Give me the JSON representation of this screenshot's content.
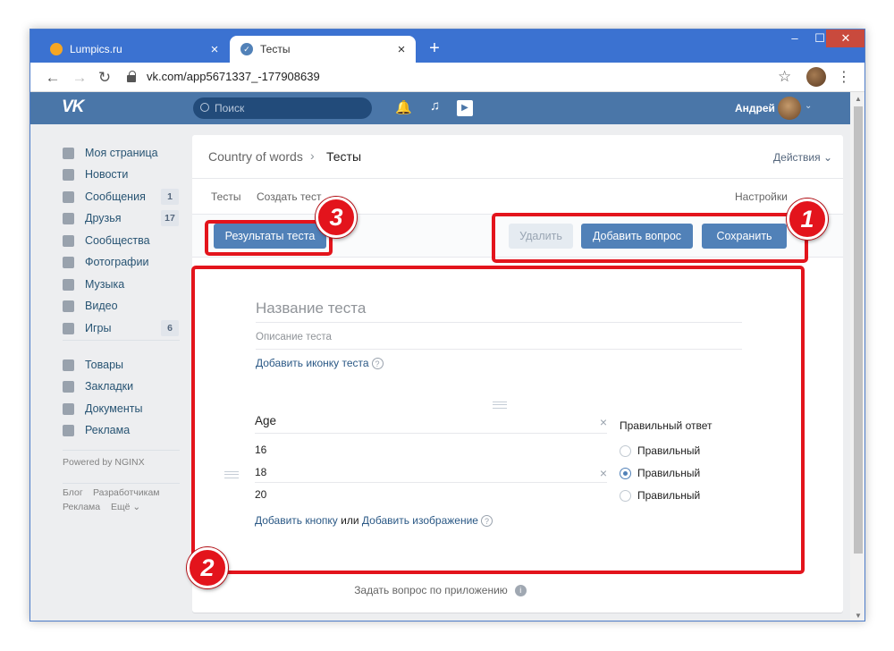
{
  "browser": {
    "tabs": [
      {
        "title": "Lumpics.ru",
        "close": "×"
      },
      {
        "title": "Тесты",
        "close": "×"
      }
    ],
    "new_tab": "+",
    "window_controls": {
      "minimize": "‒",
      "maximize": "☐",
      "close": "✕"
    },
    "nav": {
      "back": "←",
      "forward": "→",
      "reload": "↻"
    },
    "url": "vk.com/app5671337_-177908639",
    "star": "☆",
    "menu": "⋮"
  },
  "vk_header": {
    "logo": "VK",
    "search_placeholder": "Поиск",
    "bell": "🔔",
    "music": "♫",
    "play": "▶",
    "user_name": "Андрей",
    "user_chevron": "⌄"
  },
  "left_menu": {
    "items": [
      {
        "label": "Моя страница",
        "icon": "home-icon",
        "badge": ""
      },
      {
        "label": "Новости",
        "icon": "news-icon",
        "badge": ""
      },
      {
        "label": "Сообщения",
        "icon": "messages-icon",
        "badge": "1"
      },
      {
        "label": "Друзья",
        "icon": "friends-icon",
        "badge": "17"
      },
      {
        "label": "Сообщества",
        "icon": "communities-icon",
        "badge": ""
      },
      {
        "label": "Фотографии",
        "icon": "photos-icon",
        "badge": ""
      },
      {
        "label": "Музыка",
        "icon": "music-icon",
        "badge": ""
      },
      {
        "label": "Видео",
        "icon": "video-icon",
        "badge": ""
      },
      {
        "label": "Игры",
        "icon": "games-icon",
        "badge": "6"
      },
      {
        "label": "Товары",
        "icon": "goods-icon",
        "badge": ""
      },
      {
        "label": "Закладки",
        "icon": "bookmarks-icon",
        "badge": ""
      },
      {
        "label": "Документы",
        "icon": "documents-icon",
        "badge": ""
      },
      {
        "label": "Реклама",
        "icon": "ads-icon",
        "badge": ""
      }
    ],
    "powered_by": "Powered by NGINX",
    "footer_links": [
      "Блог",
      "Разработчикам",
      "Реклама",
      "Ещё ⌄"
    ]
  },
  "content": {
    "breadcrumb_app": "Country of words",
    "breadcrumb_sep": "›",
    "breadcrumb_page": "Тесты",
    "actions": "Действия ⌄",
    "subtabs": {
      "tests": "Тесты",
      "create": "Создать тест",
      "settings": "Настройки"
    },
    "buttons": {
      "results": "Результаты теста",
      "delete": "Удалить",
      "add_question": "Добавить вопрос",
      "save": "Сохранить"
    },
    "test_title_placeholder": "Название теста",
    "test_desc_placeholder": "Описание теста",
    "add_icon_link": "Добавить иконку теста",
    "help": "?",
    "question": {
      "text": "Age",
      "clear": "×",
      "answers": [
        "16",
        "18",
        "20"
      ],
      "correct_header": "Правильный ответ",
      "correct_label": "Правильный",
      "correct_selected_index": 1
    },
    "add_button_link": "Добавить кнопку",
    "or": "или",
    "add_image_link": "Добавить изображение",
    "footer_question": "Задать вопрос по приложению",
    "footer_info": "i"
  },
  "annotations": [
    "1",
    "2",
    "3"
  ],
  "colors": {
    "vk_blue": "#4a76a8",
    "button_blue": "#5181b8",
    "highlight_red": "#e3141c",
    "chrome_blue": "#3b72d1"
  }
}
